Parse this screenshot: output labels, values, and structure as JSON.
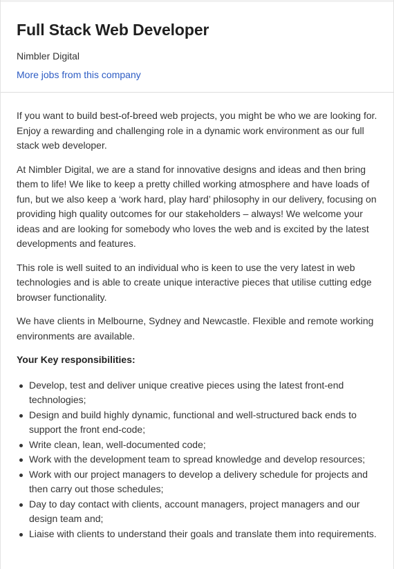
{
  "job": {
    "title": "Full Stack Web Developer",
    "company": "Nimbler Digital",
    "more_jobs_label": "More jobs from this company"
  },
  "description": {
    "paragraphs": [
      "If you want to build best-of-breed web projects, you might be who we are looking for. Enjoy a rewarding and challenging role in a dynamic work environment as our full stack web developer.",
      "At Nimbler Digital, we are a stand for innovative designs and ideas and then bring them to life!  We like to keep a pretty chilled working atmosphere and have loads of fun, but we also keep a ‘work hard, play hard’ philosophy in our delivery, focusing on providing high quality outcomes for our stakeholders – always!  We welcome your ideas and are looking for somebody who loves the web and is excited by the latest developments and features.",
      "This role is well suited to an individual who is keen to use the very latest in web technologies and is able to create unique interactive pieces that utilise cutting edge browser functionality.",
      "We have clients in Melbourne, Sydney and Newcastle.  Flexible and remote working environments are available."
    ],
    "responsibilities_heading": "Your Key responsibilities:",
    "responsibilities": [
      "Develop, test and deliver unique creative pieces using the latest front-end technologies;",
      "Design and build highly dynamic, functional and well-structured back ends to support the front end-code;",
      "Write clean, lean, well-documented code;",
      "Work with the development team to spread knowledge and develop resources;",
      "Work with our project managers to develop a delivery schedule for projects and then carry out those schedules;",
      "Day to day contact with clients, account managers, project managers and our design team and;",
      "Liaise with clients to understand their goals and translate them into requirements."
    ]
  },
  "colors": {
    "link": "#2d5cc4",
    "text": "#333333",
    "divider": "#dedede"
  }
}
